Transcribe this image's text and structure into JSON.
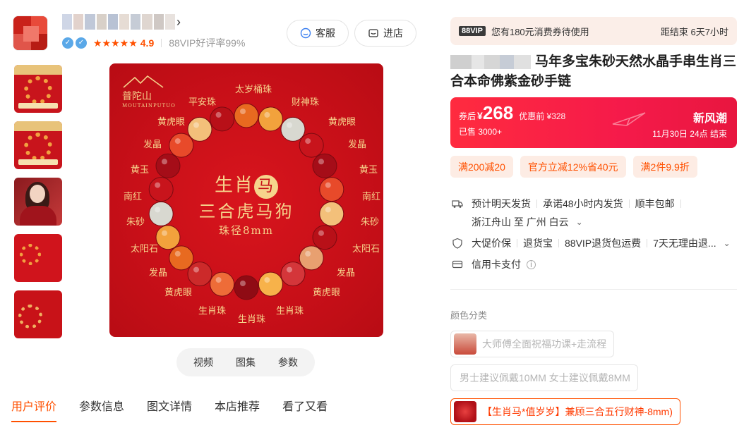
{
  "shop": {
    "rating": "4.9",
    "vip_rate": "88VIP好评率99%",
    "service_btn": "客服",
    "enter_btn": "进店"
  },
  "gallery": {
    "media_tabs": [
      "视频",
      "图集",
      "参数"
    ],
    "main_image": {
      "brand": "普陀山",
      "brand_sub": "MOUTAINPUTUO",
      "line1_pre": "生肖",
      "line1_badge": "马",
      "line2": "三合虎马狗",
      "line3": "珠径8mm",
      "labels": {
        "top": "太岁桶珠",
        "top_left": "平安珠",
        "top_right": "财神珠",
        "l1": "黄虎眼",
        "r1": "黄虎眼",
        "l2": "发晶",
        "r2": "发晶",
        "l3": "黄玉",
        "r3": "黄玉",
        "l4": "南红",
        "r4": "南红",
        "l5": "朱砂",
        "r5": "朱砂",
        "l6": "太阳石",
        "r6": "太阳石",
        "l7": "发晶",
        "r7": "发晶",
        "l8": "黄虎眼",
        "r8": "黄虎眼",
        "bottom_left": "生肖珠",
        "bottom_right": "生肖珠",
        "bottom": "生肖珠"
      }
    }
  },
  "bottom_tabs": [
    "用户评价",
    "参数信息",
    "图文详情",
    "本店推荐",
    "看了又看"
  ],
  "vip_bar": {
    "tag": "88VIP",
    "text": "您有180元消费券待使用",
    "countdown": "距结束 6天7小时"
  },
  "product": {
    "title": "马年多宝朱砂天然水晶手串生肖三合本命佛紫金砂手链"
  },
  "price": {
    "prefix": "券后",
    "currency": "¥",
    "value": "268",
    "original": "优惠前 ¥328",
    "sold": "已售 3000+",
    "campaign": "新风潮",
    "campaign_time": "11月30日 24点 结束"
  },
  "coupons": [
    "满200减20",
    "官方立减12%省40元",
    "满2件9.9折"
  ],
  "delivery": {
    "ship": "预计明天发货",
    "promise": "承诺48小时内发货",
    "express": "顺丰包邮",
    "route": "浙江舟山 至 广州 白云"
  },
  "guarantees": [
    "大促价保",
    "退货宝",
    "88VIP退货包运费",
    "7天无理由退..."
  ],
  "payment": "信用卡支付",
  "options": {
    "label": "颜色分类",
    "items": [
      "大师傅全面祝福功课+走流程",
      "男士建议佩戴10MM 女士建议佩戴8MM",
      "【生肖马*值岁岁】兼顾三合五行财神-8mm)"
    ]
  },
  "colors": {
    "accent": "#ff5000",
    "price_red": "#f51a4a",
    "image_red": "#c70f18",
    "gold": "#f6d48c"
  }
}
